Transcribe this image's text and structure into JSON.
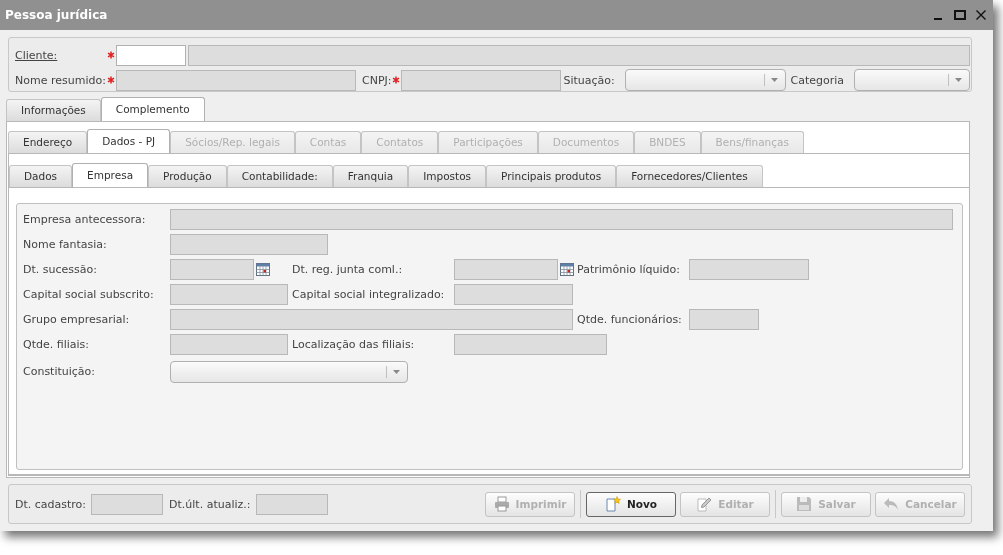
{
  "window": {
    "title": "Pessoa jurídica"
  },
  "header": {
    "client": {
      "label": "Cliente:",
      "required": true
    },
    "short_name": {
      "label": "Nome resumido:",
      "required": true
    },
    "cnpj": {
      "label": "CNPJ:",
      "required": true
    },
    "status": {
      "label": "Situação:"
    },
    "category": {
      "label": "Categoria"
    }
  },
  "main_tabs": [
    {
      "label": "Informações",
      "selected": false
    },
    {
      "label": "Complemento",
      "selected": true
    }
  ],
  "section_tabs": [
    {
      "label": "Endereço",
      "selected": false,
      "disabled": false
    },
    {
      "label": "Dados - PJ",
      "selected": true,
      "disabled": false
    },
    {
      "label": "Sócios/Rep. legais",
      "selected": false,
      "disabled": true
    },
    {
      "label": "Contas",
      "selected": false,
      "disabled": true
    },
    {
      "label": "Contatos",
      "selected": false,
      "disabled": true
    },
    {
      "label": "Participações",
      "selected": false,
      "disabled": true
    },
    {
      "label": "Documentos",
      "selected": false,
      "disabled": true
    },
    {
      "label": "BNDES",
      "selected": false,
      "disabled": true
    },
    {
      "label": "Bens/finanças",
      "selected": false,
      "disabled": true
    }
  ],
  "sub_tabs": [
    {
      "label": "Dados",
      "selected": false
    },
    {
      "label": "Empresa",
      "selected": true
    },
    {
      "label": "Produção",
      "selected": false
    },
    {
      "label": "Contabilidade:",
      "selected": false
    },
    {
      "label": "Franquia",
      "selected": false
    },
    {
      "label": "Impostos",
      "selected": false
    },
    {
      "label": "Principais produtos",
      "selected": false
    },
    {
      "label": "Fornecedores/Clientes",
      "selected": false
    }
  ],
  "form": {
    "rows": [
      [
        {
          "label": "Empresa antecessora:",
          "kind": "text"
        }
      ],
      [
        {
          "label": "Nome fantasia:",
          "kind": "text"
        }
      ],
      [
        {
          "label": "Dt. sucessão:",
          "kind": "date"
        },
        {
          "label": "Dt. reg. junta coml.:",
          "kind": "date"
        },
        {
          "label": "Patrimônio líquido:",
          "kind": "text"
        }
      ],
      [
        {
          "label": "Capital social subscrito:",
          "kind": "text"
        },
        {
          "label": "Capital social integralizado:",
          "kind": "text"
        }
      ],
      [
        {
          "label": "Grupo empresarial:",
          "kind": "text"
        },
        "",
        {
          "label": "Qtde. funcionários:",
          "kind": "text"
        }
      ],
      [
        {
          "label": "Qtde. filiais:",
          "kind": "text"
        },
        {
          "label": "Localização das filiais:",
          "kind": "text"
        }
      ],
      [
        {
          "label": "Constituição:",
          "kind": "combo"
        }
      ]
    ]
  },
  "footer": {
    "fields": [
      {
        "label": "Dt. cadastro:"
      },
      {
        "label": "Dt.últ. atualiz.:"
      }
    ],
    "buttons": [
      {
        "label": "Imprimir",
        "kind": "print",
        "disabled": true,
        "separator_before": false
      },
      {
        "label": "Novo",
        "kind": "new",
        "disabled": false,
        "separator_before": true
      },
      {
        "label": "Editar",
        "kind": "edit",
        "disabled": true,
        "separator_before": false
      },
      {
        "label": "Salvar",
        "kind": "save",
        "disabled": true,
        "separator_before": true
      },
      {
        "label": "Cancelar",
        "kind": "cancel",
        "disabled": true,
        "separator_before": false
      }
    ]
  }
}
